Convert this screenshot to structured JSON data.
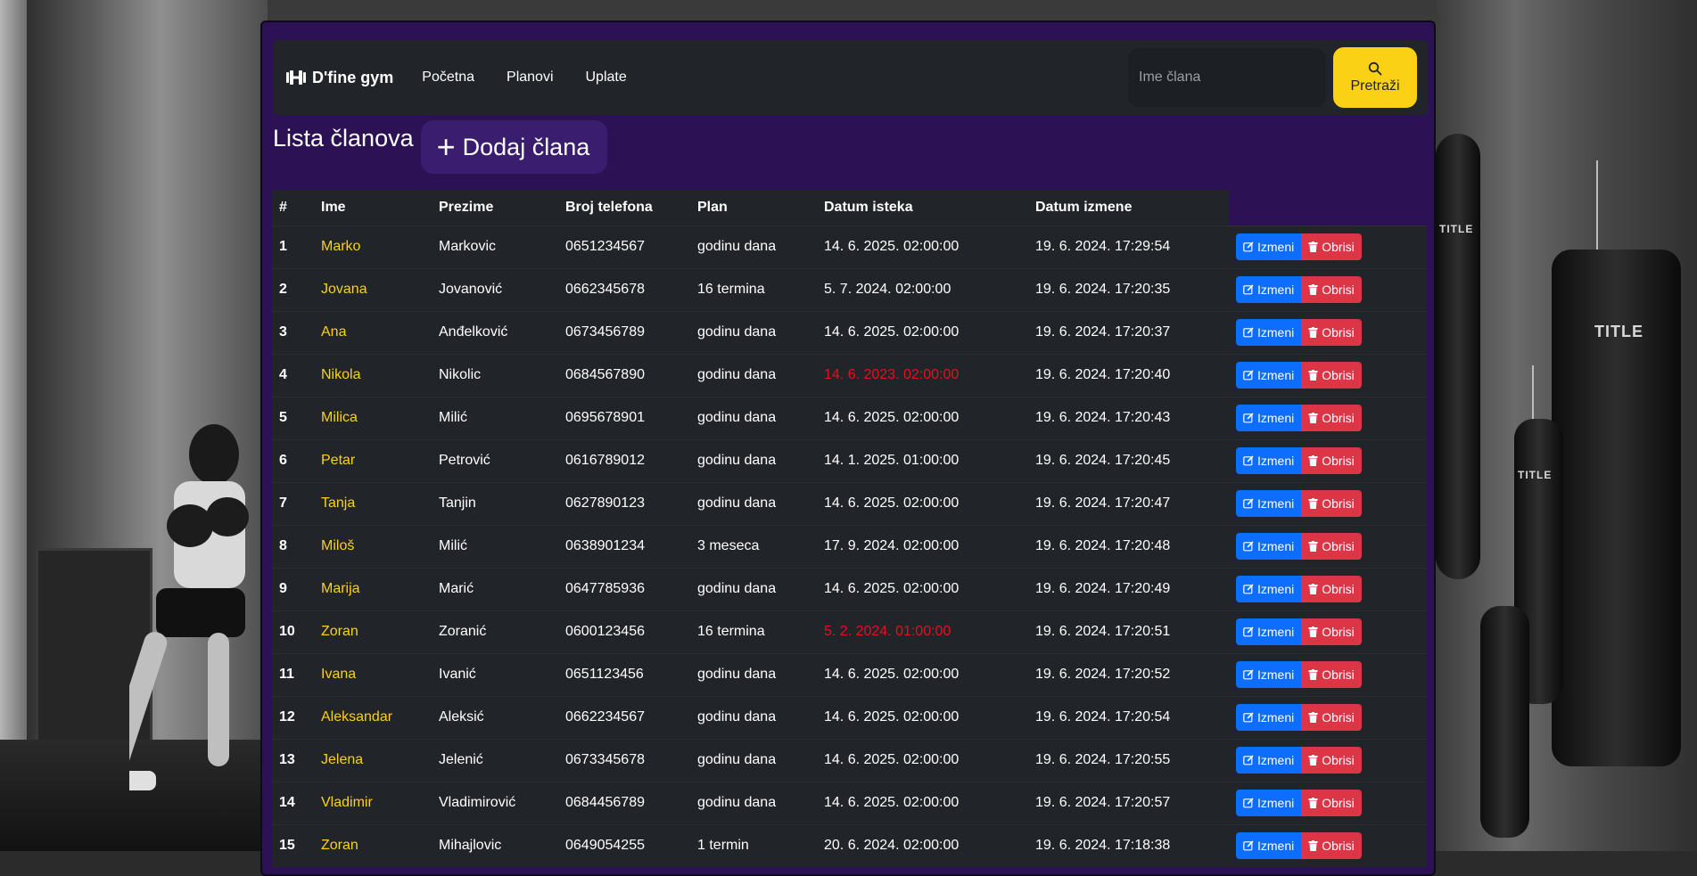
{
  "navbar": {
    "brand": "D'fine gym",
    "links": [
      "Početna",
      "Planovi",
      "Uplate"
    ],
    "search_placeholder": "Ime člana",
    "search_button": "Pretraži"
  },
  "page": {
    "title": "Lista članova",
    "add_button": "Dodaj člana"
  },
  "table": {
    "headers": [
      "#",
      "Ime",
      "Prezime",
      "Broj telefona",
      "Plan",
      "Datum isteka",
      "Datum izmene"
    ],
    "edit_label": "Izmeni",
    "delete_label": "Obrisi",
    "rows": [
      {
        "id": "1",
        "ime": "Marko",
        "prezime": "Markovic",
        "telefon": "0651234567",
        "plan": "godinu dana",
        "istek": "14. 6. 2025. 02:00:00",
        "izmena": "19. 6. 2024. 17:29:54",
        "expired": false
      },
      {
        "id": "2",
        "ime": "Jovana",
        "prezime": "Jovanović",
        "telefon": "0662345678",
        "plan": "16 termina",
        "istek": "5. 7. 2024. 02:00:00",
        "izmena": "19. 6. 2024. 17:20:35",
        "expired": false
      },
      {
        "id": "3",
        "ime": "Ana",
        "prezime": "Anđelković",
        "telefon": "0673456789",
        "plan": "godinu dana",
        "istek": "14. 6. 2025. 02:00:00",
        "izmena": "19. 6. 2024. 17:20:37",
        "expired": false
      },
      {
        "id": "4",
        "ime": "Nikola",
        "prezime": "Nikolic",
        "telefon": "0684567890",
        "plan": "godinu dana",
        "istek": "14. 6. 2023. 02:00:00",
        "izmena": "19. 6. 2024. 17:20:40",
        "expired": true
      },
      {
        "id": "5",
        "ime": "Milica",
        "prezime": "Milić",
        "telefon": "0695678901",
        "plan": "godinu dana",
        "istek": "14. 6. 2025. 02:00:00",
        "izmena": "19. 6. 2024. 17:20:43",
        "expired": false
      },
      {
        "id": "6",
        "ime": "Petar",
        "prezime": "Petrović",
        "telefon": "0616789012",
        "plan": "godinu dana",
        "istek": "14. 1. 2025. 01:00:00",
        "izmena": "19. 6. 2024. 17:20:45",
        "expired": false
      },
      {
        "id": "7",
        "ime": "Tanja",
        "prezime": "Tanjin",
        "telefon": "0627890123",
        "plan": "godinu dana",
        "istek": "14. 6. 2025. 02:00:00",
        "izmena": "19. 6. 2024. 17:20:47",
        "expired": false
      },
      {
        "id": "8",
        "ime": "Miloš",
        "prezime": "Milić",
        "telefon": "0638901234",
        "plan": "3 meseca",
        "istek": "17. 9. 2024. 02:00:00",
        "izmena": "19. 6. 2024. 17:20:48",
        "expired": false
      },
      {
        "id": "9",
        "ime": "Marija",
        "prezime": "Marić",
        "telefon": "0647785936",
        "plan": "godinu dana",
        "istek": "14. 6. 2025. 02:00:00",
        "izmena": "19. 6. 2024. 17:20:49",
        "expired": false
      },
      {
        "id": "10",
        "ime": "Zoran",
        "prezime": "Zoranić",
        "telefon": "0600123456",
        "plan": "16 termina",
        "istek": "5. 2. 2024. 01:00:00",
        "izmena": "19. 6. 2024. 17:20:51",
        "expired": true
      },
      {
        "id": "11",
        "ime": "Ivana",
        "prezime": "Ivanić",
        "telefon": "0651123456",
        "plan": "godinu dana",
        "istek": "14. 6. 2025. 02:00:00",
        "izmena": "19. 6. 2024. 17:20:52",
        "expired": false
      },
      {
        "id": "12",
        "ime": "Aleksandar",
        "prezime": "Aleksić",
        "telefon": "0662234567",
        "plan": "godinu dana",
        "istek": "14. 6. 2025. 02:00:00",
        "izmena": "19. 6. 2024. 17:20:54",
        "expired": false
      },
      {
        "id": "13",
        "ime": "Jelena",
        "prezime": "Jelenić",
        "telefon": "0673345678",
        "plan": "godinu dana",
        "istek": "14. 6. 2025. 02:00:00",
        "izmena": "19. 6. 2024. 17:20:55",
        "expired": false
      },
      {
        "id": "14",
        "ime": "Vladimir",
        "prezime": "Vladimirović",
        "telefon": "0684456789",
        "plan": "godinu dana",
        "istek": "14. 6. 2025. 02:00:00",
        "izmena": "19. 6. 2024. 17:20:57",
        "expired": false
      },
      {
        "id": "15",
        "ime": "Zoran",
        "prezime": "Mihajlovic",
        "telefon": "0649054255",
        "plan": "1 termin",
        "istek": "20. 6. 2024. 02:00:00",
        "izmena": "19. 6. 2024. 17:18:38",
        "expired": false
      }
    ]
  },
  "colors": {
    "panel_bg": "#2c1254",
    "navbar_bg": "#212529",
    "accent_yellow": "#fbd116",
    "expired_red": "#e3121c",
    "edit_blue": "#0d6efd",
    "delete_red": "#dc3545"
  },
  "background": {
    "bag_labels": [
      "TITLE",
      "TITLE",
      "TITLE"
    ]
  },
  "icons": {
    "brand": "dumbbell-icon",
    "search": "search-icon",
    "add": "plus-icon",
    "edit": "edit-icon",
    "delete": "trash-icon"
  }
}
